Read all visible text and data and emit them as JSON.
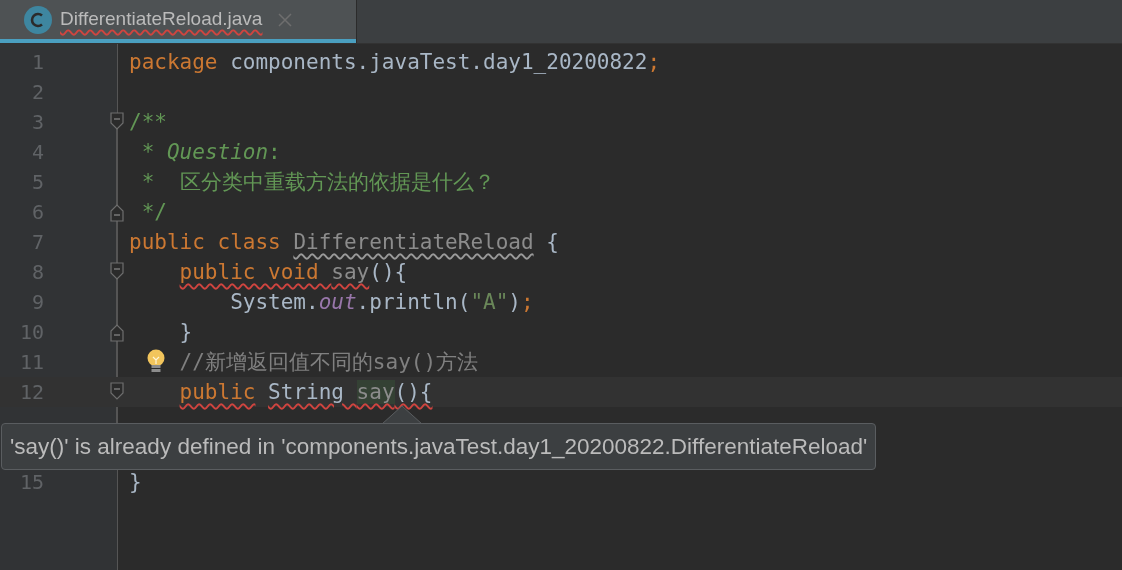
{
  "tabs": [
    {
      "label": "DifferentiateReload.java",
      "selected": true,
      "error": true
    }
  ],
  "lines": [
    {
      "number": "1",
      "current": false,
      "tokens": [
        {
          "kind": "kw",
          "text": "package "
        },
        {
          "kind": "plain",
          "text": "components.javaTest.day1_20200822"
        },
        {
          "kind": "kw",
          "text": ";"
        }
      ]
    },
    {
      "number": "2",
      "current": false
    },
    {
      "number": "3",
      "current": false,
      "fold_start": true,
      "tokens": [
        {
          "kind": "doc",
          "text": "/**"
        }
      ]
    },
    {
      "number": "4",
      "current": false,
      "tokens": [
        {
          "kind": "doc",
          "text": " * "
        },
        {
          "kind": "doctag",
          "text": "Question"
        },
        {
          "kind": "doc",
          "text": ":"
        }
      ]
    },
    {
      "number": "5",
      "current": false,
      "tokens": [
        {
          "kind": "doc",
          "text": " *  区分类中重载方法的依据是什么？"
        }
      ]
    },
    {
      "number": "6",
      "current": false,
      "fold_end": true,
      "tokens": [
        {
          "kind": "doc",
          "text": " */"
        }
      ]
    },
    {
      "number": "7",
      "current": false,
      "tokens": [
        {
          "kind": "kw",
          "text": "public class "
        },
        {
          "kind": "unused",
          "text": "DifferentiateReload",
          "warning": true
        },
        {
          "kind": "plain",
          "text": " {"
        }
      ]
    },
    {
      "number": "8",
      "current": false,
      "fold_start": true,
      "tokens": [
        {
          "kind": "kw",
          "text": "    public void ",
          "error": true
        },
        {
          "kind": "unused",
          "text": "say",
          "error": true
        },
        {
          "kind": "plain",
          "text": "(){"
        }
      ]
    },
    {
      "number": "9",
      "current": false,
      "tokens": [
        {
          "kind": "plain",
          "text": "        System."
        },
        {
          "kind": "field",
          "text": "out"
        },
        {
          "kind": "plain",
          "text": ".println("
        },
        {
          "kind": "string",
          "text": "\"A\""
        },
        {
          "kind": "plain",
          "text": ")"
        },
        {
          "kind": "kw",
          "text": ";"
        }
      ]
    },
    {
      "number": "10",
      "current": false,
      "fold_end": true,
      "tokens": [
        {
          "kind": "plain",
          "text": "    }"
        }
      ]
    },
    {
      "number": "11",
      "current": false,
      "bulb": true,
      "tokens": [
        {
          "kind": "comment",
          "text": "    //新增返回值不同的say()方法"
        }
      ]
    },
    {
      "number": "12",
      "current": true,
      "fold_start": true,
      "tokens": [
        {
          "kind": "kw",
          "text": "    public",
          "error": true
        },
        {
          "kind": "plain",
          "text": " String ",
          "error": true
        },
        {
          "kind": "match",
          "text": "say",
          "error": true
        },
        {
          "kind": "plain",
          "text": "(){",
          "error": true
        }
      ]
    }
  ],
  "lines_below_tooltip": [
    {
      "number": "15",
      "current": false,
      "tokens": [
        {
          "kind": "plain",
          "text": "}"
        }
      ]
    }
  ],
  "tooltip": {
    "text": "'say()' is already defined in 'components.javaTest.day1_20200822.DifferentiateReload'"
  }
}
